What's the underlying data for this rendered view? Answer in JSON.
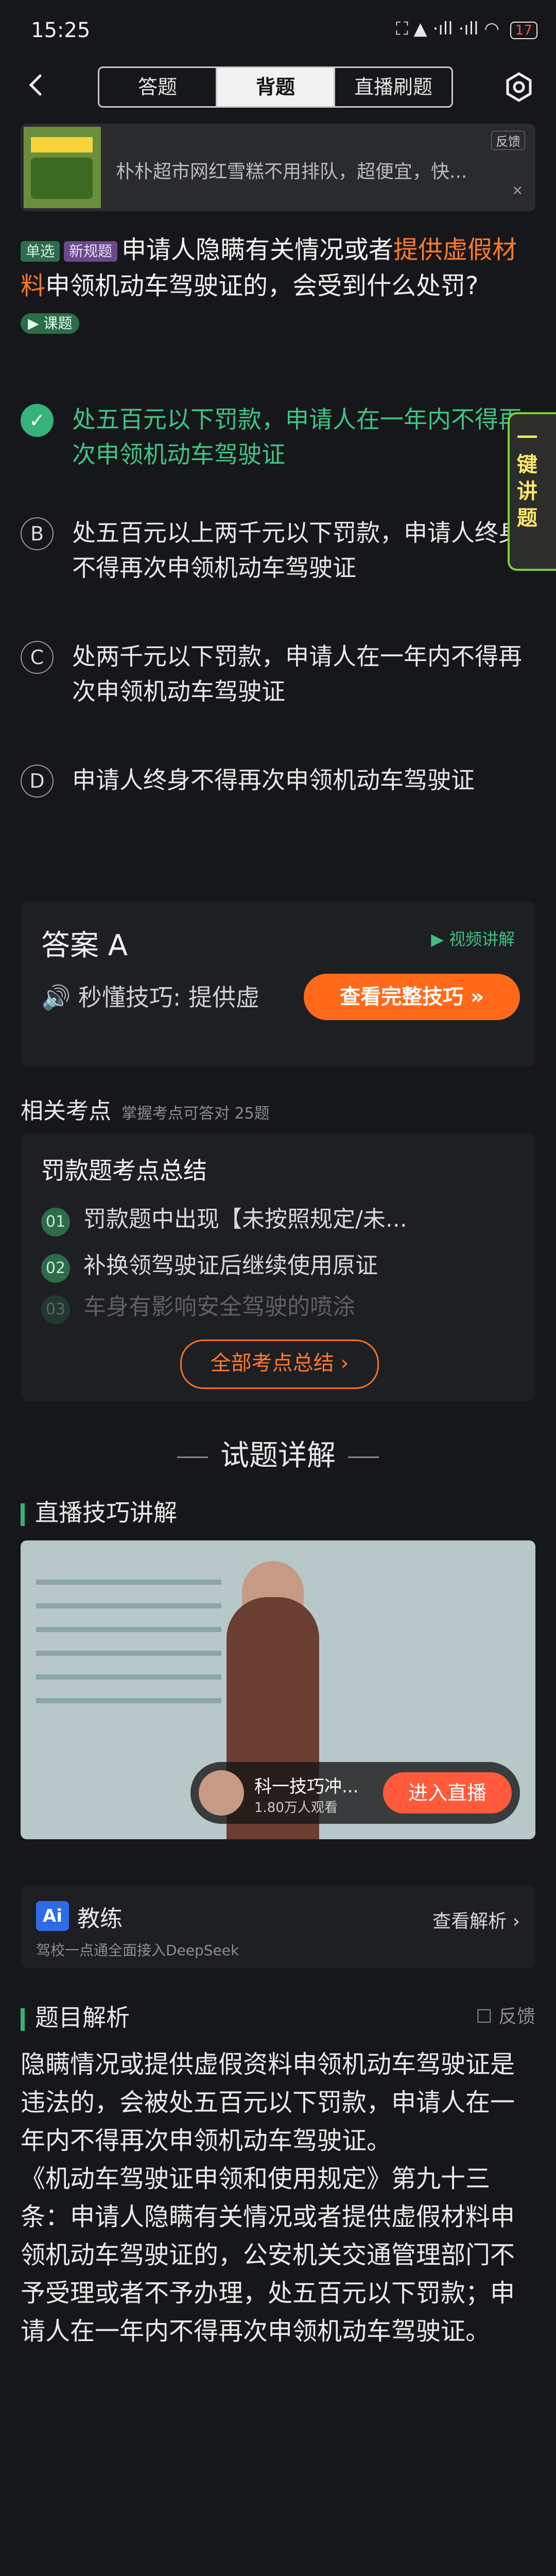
{
  "status_bar": {
    "time": "15:25",
    "indicators": "⛶ ▲ ·ıll ·ıll ◠",
    "battery": "17"
  },
  "nav": {
    "tabs": [
      "答题",
      "背题",
      "直播刷题"
    ],
    "active_tab": 1
  },
  "ad": {
    "text": "朴朴超市网红雪糕不用排队，超便宜，快...",
    "tag": "反馈"
  },
  "question": {
    "type_badge": "单选",
    "new_badge": "新规题",
    "text_before": "申请人隐瞒有关情况或者",
    "text_highlight": "提供虚假材料",
    "text_after": "申领机动车驾驶证的，会受到什么处罚?",
    "lesson_badge": "▶ 课题"
  },
  "options": [
    {
      "letter": "A",
      "text": "处五百元以下罚款，申请人在一年内不得再次申领机动车驾驶证",
      "correct": true
    },
    {
      "letter": "B",
      "text": "处五百元以上两千元以下罚款，申请人终身不得再次申领机动车驾驶证",
      "correct": false
    },
    {
      "letter": "C",
      "text": "处两千元以下罚款，申请人在一年内不得再次申领机动车驾驶证",
      "correct": false
    },
    {
      "letter": "D",
      "text": "申请人终身不得再次申领机动车驾驶证",
      "correct": false
    }
  ],
  "side_button": "一键讲题",
  "answer": {
    "label": "答案  A",
    "video_link": "▶ 视频讲解",
    "tip_prefix": "🔊 秒懂技巧: 提供虚",
    "tip_button": "查看完整技巧 »"
  },
  "knowledge": {
    "title": "相关考点",
    "subtitle": "掌握考点可答对 25题",
    "card_title": "罚款题考点总结",
    "items": [
      {
        "num": "01",
        "text": "罚款题中出现【未按照规定/未..."
      },
      {
        "num": "02",
        "text": "补换领驾驶证后继续使用原证"
      },
      {
        "num": "03",
        "text": "车身有影响安全驾驶的喷涂"
      }
    ],
    "all_button": "全部考点总结 ›"
  },
  "section_title": "试题详解",
  "live": {
    "title": "直播技巧讲解",
    "teacher": "科一技巧冲...",
    "viewers": "1.80万人观看",
    "enter": "进入直播"
  },
  "coach": {
    "logo": "Ai",
    "name": "教练",
    "sub": "驾校一点通全面接入DeepSeek",
    "link": "查看解析 ›"
  },
  "analysis": {
    "title": "题目解析",
    "feedback": "☐ 反馈",
    "paragraphs": [
      "隐瞒情况或提供虚假资料申领机动车驾驶证是违法的，会被处五百元以下罚款，申请人在一年内不得再次申领机动车驾驶证。",
      "《机动车驾驶证申领和使用规定》第九十三条：申请人隐瞒有关情况或者提供虚假材料申领机动车驾驶证的，公安机关交通管理部门不予受理或者不予办理，处五百元以下罚款；申请人在一年内不得再次申领机动车驾驶证。"
    ]
  }
}
